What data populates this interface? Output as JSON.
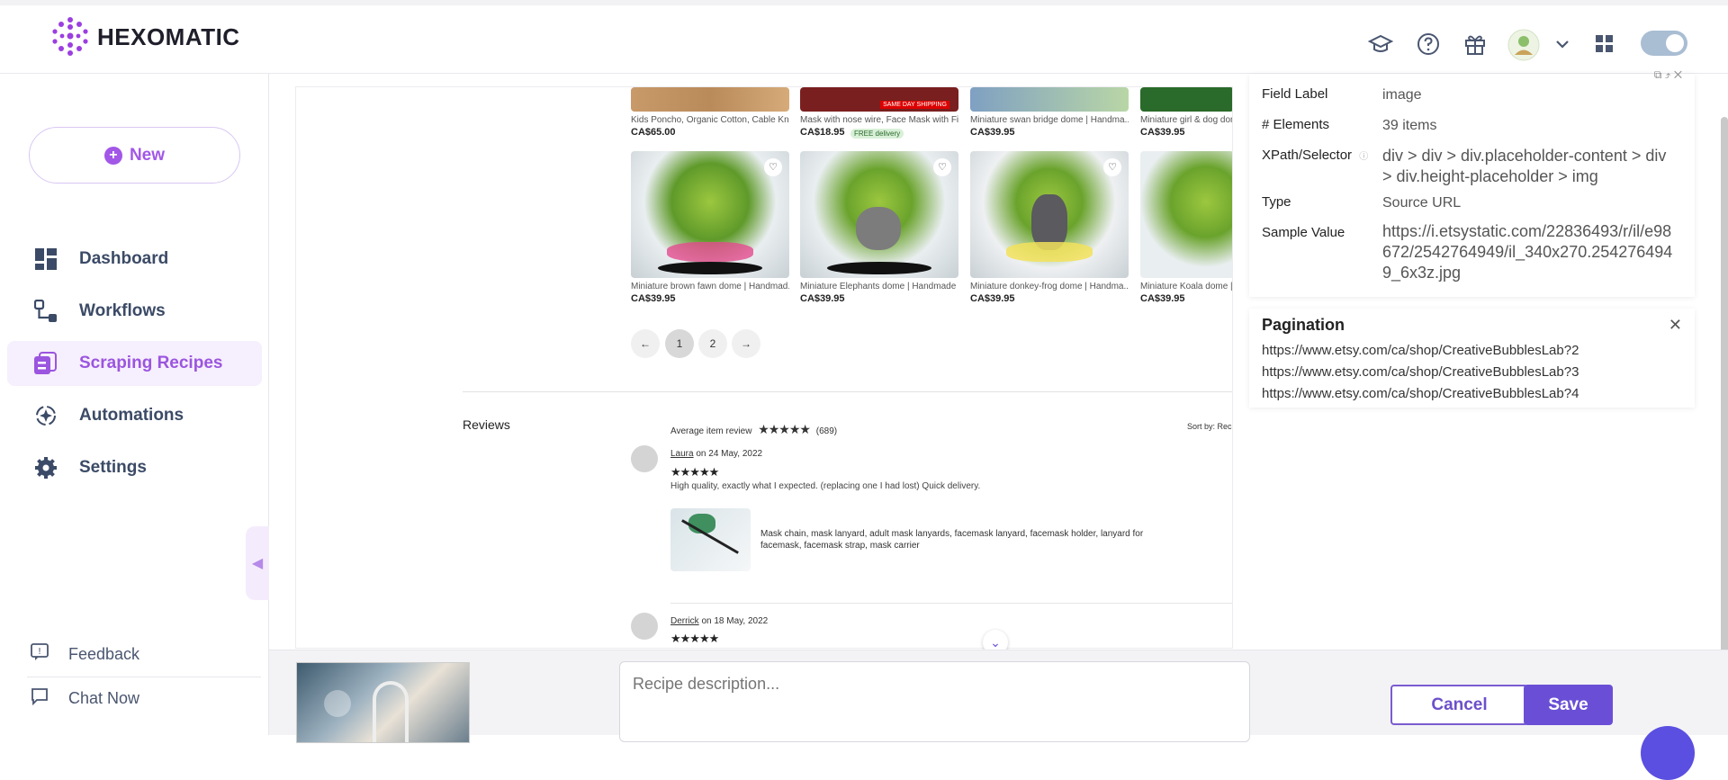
{
  "app": {
    "name": "HEXOMATIC"
  },
  "header": {
    "icons": [
      "graduation-cap-icon",
      "help-circle-icon",
      "gift-icon",
      "avatar",
      "chevron-down-icon",
      "apps-grid-icon"
    ]
  },
  "sidebar": {
    "new_label": "New",
    "items": [
      {
        "label": "Dashboard",
        "icon": "dashboard-icon"
      },
      {
        "label": "Workflows",
        "icon": "workflow-icon"
      },
      {
        "label": "Scraping Recipes",
        "icon": "scraping-recipes-icon",
        "active": true
      },
      {
        "label": "Automations",
        "icon": "automations-icon"
      },
      {
        "label": "Settings",
        "icon": "gear-icon"
      }
    ],
    "footer": [
      {
        "label": "Feedback",
        "icon": "feedback-icon"
      },
      {
        "label": "Chat Now",
        "icon": "chat-icon"
      }
    ]
  },
  "preview": {
    "top_row": [
      {
        "caption": "Kids Poncho, Organic Cotton, Cable Kn...",
        "price": "CA$65.00"
      },
      {
        "caption": "Mask with nose wire, Face Mask with Fil...",
        "price": "CA$18.95",
        "badge": "FREE delivery",
        "ribbon": "SAME DAY SHIPPING"
      },
      {
        "caption": "Miniature swan bridge dome | Handma...",
        "price": "CA$39.95"
      },
      {
        "caption": "Miniature girl & dog dom",
        "price": "CA$39.95"
      }
    ],
    "products": [
      {
        "caption": "Miniature brown fawn dome | Handmad...",
        "price": "CA$39.95"
      },
      {
        "caption": "Miniature Elephants dome | Handmade ...",
        "price": "CA$39.95"
      },
      {
        "caption": "Miniature donkey-frog dome | Handma...",
        "price": "CA$39.95"
      },
      {
        "caption": "Miniature Koala dome | H",
        "price": "CA$39.95"
      }
    ],
    "pagination": {
      "prev": "←",
      "pages": [
        "1",
        "2"
      ],
      "next": "→"
    },
    "reviews_heading": "Reviews",
    "avg_label": "Average item review",
    "stars": "★★★★★",
    "review_count": "(689)",
    "sort_label": "Sort by: Rec",
    "reviews": [
      {
        "name": "Laura",
        "date": "on 24 May, 2022",
        "stars": "★★★★★",
        "text": "High quality, exactly what I expected. (replacing one I had lost) Quick delivery.",
        "item_title": "Mask chain, mask lanyard, adult mask lanyards, facemask lanyard, facemask holder, lanyard for facemask, facemask strap, mask carrier"
      },
      {
        "name": "Derrick",
        "date": "on 18 May, 2022",
        "stars": "★★★★★"
      }
    ]
  },
  "field_panel": {
    "rows": [
      {
        "label": "Field Label",
        "value": "image"
      },
      {
        "label": "# Elements",
        "value": "39 items"
      },
      {
        "label": "XPath/Selector",
        "value": "div > div > div.placeholder-content > div > div.height-placeholder > img"
      },
      {
        "label": "Type",
        "value": "Source URL"
      },
      {
        "label": "Sample Value",
        "value": "https://i.etsystatic.com/22836493/r/il/e98672/2542764949/il_340x270.2542764949_6x3z.jpg"
      }
    ]
  },
  "pagination_panel": {
    "title": "Pagination",
    "urls": [
      "https://www.etsy.com/ca/shop/CreativeBubblesLab?2",
      "https://www.etsy.com/ca/shop/CreativeBubblesLab?3",
      "https://www.etsy.com/ca/shop/CreativeBubblesLab?4"
    ]
  },
  "bottom": {
    "description_placeholder": "Recipe description...",
    "cancel_label": "Cancel",
    "save_label": "Save"
  },
  "colors": {
    "accent": "#6a4fd6",
    "brand_purple": "#a257e7",
    "active_bg": "#f6effd"
  }
}
